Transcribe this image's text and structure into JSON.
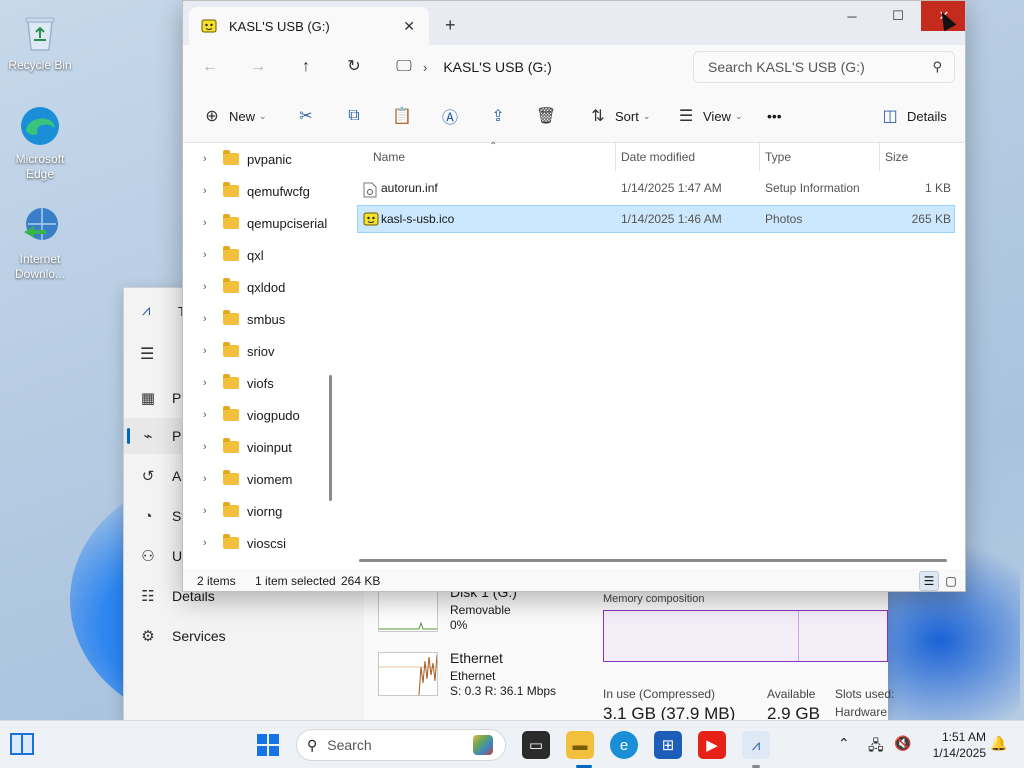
{
  "desktop": {
    "icons": [
      {
        "label": "Recycle Bin",
        "icon": "recycle-bin-icon"
      },
      {
        "label": "Microsoft Edge",
        "icon": "edge-icon"
      },
      {
        "label": "Internet Downlo...",
        "icon": "idm-icon"
      }
    ]
  },
  "task_manager": {
    "title_partial": "T",
    "sidebar": [
      {
        "label": "Pr",
        "icon": "processes-icon"
      },
      {
        "label": "Pe",
        "icon": "performance-icon",
        "active": true
      },
      {
        "label": "Ap",
        "icon": "app-history-icon"
      },
      {
        "label": "St",
        "icon": "startup-icon"
      },
      {
        "label": "Us",
        "icon": "users-icon"
      },
      {
        "label": "Details",
        "icon": "details-icon"
      },
      {
        "label": "Services",
        "icon": "services-icon"
      }
    ],
    "perf": {
      "disk_title": "Disk 1 (G:)",
      "disk_sub": "Removable",
      "disk_value": "0%",
      "eth_title": "Ethernet",
      "eth_sub": "Ethernet",
      "eth_value": "S: 0.3 R: 36.1 Mbps",
      "memory_composition": "Memory composition",
      "in_use_label": "In use (Compressed)",
      "in_use_value": "3.1 GB (37.9 MB)",
      "available_label": "Available",
      "available_value": "2.9 GB",
      "slots_label": "Slots used:",
      "hardware_label": "Hardware"
    }
  },
  "explorer": {
    "tab_title": "KASL'S USB (G:)",
    "address_segment": "KASL'S USB (G:)",
    "search_placeholder": "Search KASL'S USB (G:)",
    "commands": {
      "new": "New",
      "sort": "Sort",
      "view": "View",
      "more": "•••",
      "details": "Details"
    },
    "tree": [
      "pvpanic",
      "qemufwcfg",
      "qemupciserial",
      "qxl",
      "qxldod",
      "smbus",
      "sriov",
      "viofs",
      "viogpudo",
      "vioinput",
      "viomem",
      "viorng",
      "vioscsi"
    ],
    "columns": {
      "name": "Name",
      "date": "Date modified",
      "type": "Type",
      "size": "Size"
    },
    "files": [
      {
        "name": "autorun.inf",
        "date": "1/14/2025 1:47 AM",
        "type": "Setup Information",
        "size": "1 KB",
        "selected": false
      },
      {
        "name": "kasl-s-usb.ico",
        "date": "1/14/2025 1:46 AM",
        "type": "Photos",
        "size": "265 KB",
        "selected": true
      }
    ],
    "status": {
      "items": "2 items",
      "selected": "1 item selected",
      "selected_size": "264 KB"
    }
  },
  "taskbar": {
    "search_placeholder": "Search",
    "time": "1:51 AM",
    "date": "1/14/2025"
  },
  "colors": {
    "accent": "#0067c0",
    "selection": "#cce8ff",
    "close_red": "#c42b1c",
    "folder": "#f3c03e"
  }
}
